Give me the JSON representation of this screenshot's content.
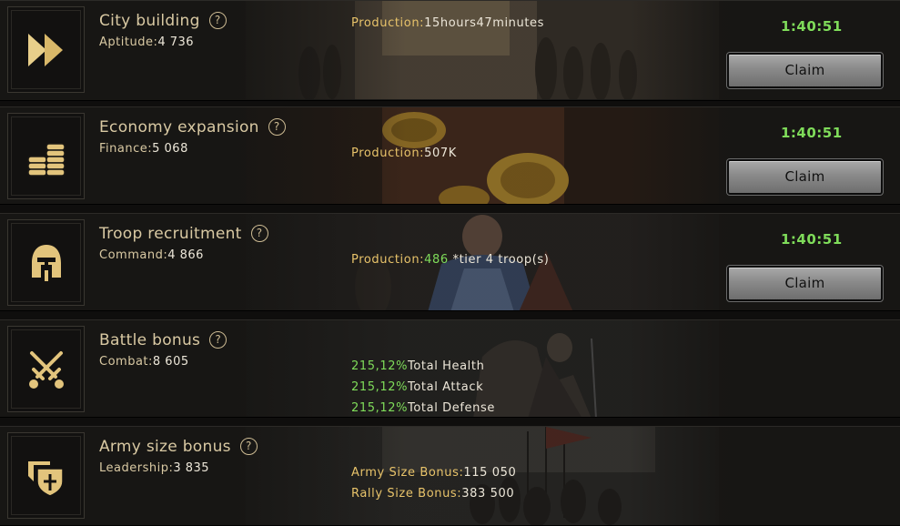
{
  "rows": [
    {
      "title": "City building",
      "stat_label": "Aptitude:",
      "stat_value": "4 736",
      "production_label": "Production:",
      "production_value": "15hours47minutes",
      "timer": "1:40:51",
      "claim_label": "Claim",
      "icon": "fast-forward-icon"
    },
    {
      "title": "Economy expansion",
      "stat_label": "Finance:",
      "stat_value": "5 068",
      "production_label": "Production:",
      "production_value": "507K",
      "timer": "1:40:51",
      "claim_label": "Claim",
      "icon": "coins-icon"
    },
    {
      "title": "Troop recruitment",
      "stat_label": "Command:",
      "stat_value": "4 866",
      "production_label": "Production:",
      "production_amount": "486",
      "production_suffix": " *tier 4 troop(s)",
      "timer": "1:40:51",
      "claim_label": "Claim",
      "icon": "helmet-icon"
    },
    {
      "title": "Battle bonus",
      "stat_label": "Combat:",
      "stat_value": "8 605",
      "bonuses": [
        {
          "percent": "215,12%",
          "label": "Total Health"
        },
        {
          "percent": "215,12%",
          "label": "Total Attack"
        },
        {
          "percent": "215,12%",
          "label": "Total Defense"
        }
      ],
      "icon": "crossed-swords-icon"
    },
    {
      "title": "Army size bonus",
      "stat_label": "Leadership:",
      "stat_value": "3 835",
      "army_size_label": "Army Size Bonus:",
      "army_size_value": "115 050",
      "rally_size_label": "Rally Size Bonus:",
      "rally_size_value": "383 500",
      "icon": "banner-shield-icon"
    }
  ],
  "help_glyph": "?",
  "colors": {
    "gold": "#e8c36a",
    "green": "#7fdc5a",
    "label": "#d9c9a3"
  }
}
